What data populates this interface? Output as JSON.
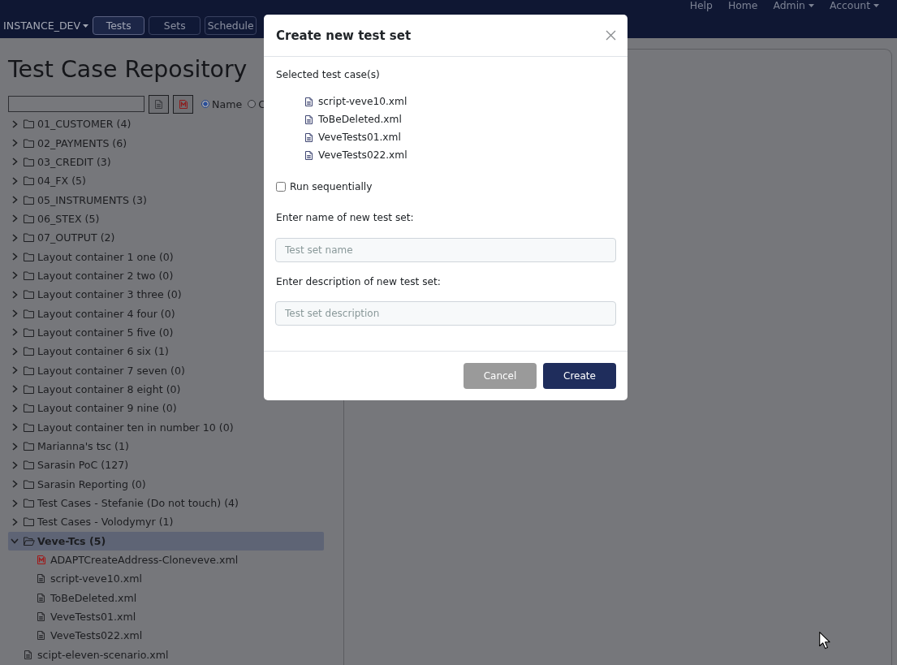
{
  "navbar": {
    "links": [
      {
        "label": "Help",
        "dropdown": false
      },
      {
        "label": "Home",
        "dropdown": false
      },
      {
        "label": "Admin",
        "dropdown": true
      },
      {
        "label": "Account",
        "dropdown": true
      }
    ],
    "instance": {
      "label": "INSTANCE_DEV",
      "dropdown": true
    },
    "tabs": [
      {
        "label": "Tests",
        "selected": true
      },
      {
        "label": "Sets",
        "selected": false
      },
      {
        "label": "Schedule",
        "selected": false
      }
    ]
  },
  "repository": {
    "title": "Test Case Repository",
    "search_modes": [
      {
        "label": "Name",
        "selected": true
      },
      {
        "label": "C",
        "selected": false
      }
    ],
    "tree": [
      {
        "kind": "folder",
        "label": "01_CUSTOMER (4)",
        "expanded": false,
        "selected": false
      },
      {
        "kind": "folder",
        "label": "02_PAYMENTS (6)",
        "expanded": false,
        "selected": false
      },
      {
        "kind": "folder",
        "label": "03_CREDIT (3)",
        "expanded": false,
        "selected": false
      },
      {
        "kind": "folder",
        "label": "04_FX (5)",
        "expanded": false,
        "selected": false
      },
      {
        "kind": "folder",
        "label": "05_INSTRUMENTS (3)",
        "expanded": false,
        "selected": false
      },
      {
        "kind": "folder",
        "label": "06_STEX (5)",
        "expanded": false,
        "selected": false
      },
      {
        "kind": "folder",
        "label": "07_OUTPUT (2)",
        "expanded": false,
        "selected": false
      },
      {
        "kind": "folder",
        "label": "Layout container 1 one (0)",
        "expanded": false,
        "selected": false
      },
      {
        "kind": "folder",
        "label": "Layout container 2 two (0)",
        "expanded": false,
        "selected": false
      },
      {
        "kind": "folder",
        "label": "Layout container 3 three (0)",
        "expanded": false,
        "selected": false
      },
      {
        "kind": "folder",
        "label": "Layout container 4 four (0)",
        "expanded": false,
        "selected": false
      },
      {
        "kind": "folder",
        "label": "Layout container 5 five (0)",
        "expanded": false,
        "selected": false
      },
      {
        "kind": "folder",
        "label": "Layout container 6 six (1)",
        "expanded": false,
        "selected": false
      },
      {
        "kind": "folder",
        "label": "Layout container 7 seven (0)",
        "expanded": false,
        "selected": false
      },
      {
        "kind": "folder",
        "label": "Layout container 8 eight (0)",
        "expanded": false,
        "selected": false
      },
      {
        "kind": "folder",
        "label": "Layout container 9 nine (0)",
        "expanded": false,
        "selected": false
      },
      {
        "kind": "folder",
        "label": "Layout container ten in number 10 (0)",
        "expanded": false,
        "selected": false
      },
      {
        "kind": "folder",
        "label": "Marianna's tsc (1)",
        "expanded": false,
        "selected": false
      },
      {
        "kind": "folder",
        "label": "Sarasin PoC (127)",
        "expanded": false,
        "selected": false
      },
      {
        "kind": "folder",
        "label": "Sarasin Reporting (0)",
        "expanded": false,
        "selected": false
      },
      {
        "kind": "folder",
        "label": "Test Cases - Stefanie (Do not touch) (4)",
        "expanded": false,
        "selected": false
      },
      {
        "kind": "folder",
        "label": "Test Cases - Volodymyr (1)",
        "expanded": false,
        "selected": false
      },
      {
        "kind": "folder",
        "label": "Veve-Tcs (5)",
        "expanded": true,
        "selected": true,
        "children": [
          {
            "kind": "mfile",
            "label": "ADAPTCreateAddress-Cloneveve.xml",
            "selected": false
          },
          {
            "kind": "doc",
            "label": "script-veve10.xml",
            "selected": false
          },
          {
            "kind": "doc",
            "label": "ToBeDeleted.xml",
            "selected": false
          },
          {
            "kind": "doc",
            "label": "VeveTests01.xml",
            "selected": false
          },
          {
            "kind": "doc",
            "label": "VeveTests022.xml",
            "selected": false
          }
        ]
      },
      {
        "kind": "doc",
        "label": "scipt-eleven-scenario.xml",
        "selected": false
      }
    ]
  },
  "dialog": {
    "title": "Create new test set",
    "section_label": "Selected test case(s)",
    "selected_cases": [
      "script-veve10.xml",
      "ToBeDeleted.xml",
      "VeveTests01.xml",
      "VeveTests022.xml"
    ],
    "run_sequentially": {
      "label": "Run sequentially",
      "checked": false
    },
    "name_label": "Enter name of new test set:",
    "name_field": {
      "placeholder": "Test set name"
    },
    "description_label": "Enter description of new test set:",
    "description_field": {
      "placeholder": "Test set description"
    },
    "buttons": [
      {
        "kind": "secondary",
        "label": "Cancel"
      },
      {
        "kind": "primary",
        "label": "Create"
      }
    ]
  }
}
